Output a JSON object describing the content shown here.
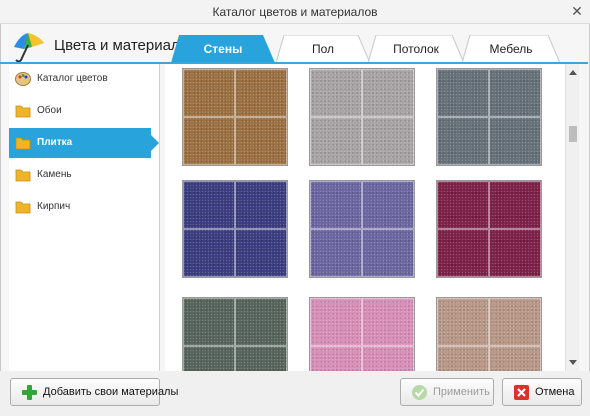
{
  "window": {
    "title": "Каталог цветов и материалов"
  },
  "app": {
    "title": "Цвета и материалы"
  },
  "tabs": [
    {
      "label": "Стены",
      "active": true
    },
    {
      "label": "Пол",
      "active": false
    },
    {
      "label": "Потолок",
      "active": false
    },
    {
      "label": "Мебель",
      "active": false
    }
  ],
  "sidebar": {
    "items": [
      {
        "label": "Каталог цветов",
        "icon": "palette-icon",
        "selected": false
      },
      {
        "label": "Обои",
        "icon": "folder-icon",
        "selected": false
      },
      {
        "label": "Плитка",
        "icon": "folder-icon",
        "selected": true
      },
      {
        "label": "Камень",
        "icon": "folder-icon",
        "selected": false
      },
      {
        "label": "Кирпич",
        "icon": "folder-icon",
        "selected": false
      }
    ]
  },
  "swatches": [
    {
      "color": "#9c7040"
    },
    {
      "color": "#a8a4a6"
    },
    {
      "color": "#66717a"
    },
    {
      "color": "#3a3c80"
    },
    {
      "color": "#6c66a2"
    },
    {
      "color": "#7e2048"
    },
    {
      "color": "#56645c"
    },
    {
      "color": "#d890b8"
    },
    {
      "color": "#b89888"
    }
  ],
  "footer": {
    "add_label": "Добавить свои материалы",
    "apply_label": "Применить",
    "cancel_label": "Отмена"
  },
  "colors": {
    "accent": "#29a3dc"
  }
}
